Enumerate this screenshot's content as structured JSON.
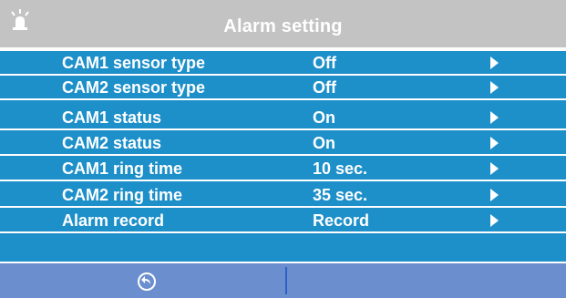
{
  "header": {
    "icon": "alarm-icon",
    "title": "Alarm setting"
  },
  "rows": [
    {
      "label": "CAM1 sensor type",
      "value": "Off"
    },
    {
      "label": "CAM2 sensor type",
      "value": "Off"
    },
    {
      "label": "CAM1 status",
      "value": "On"
    },
    {
      "label": "CAM2 status",
      "value": "On"
    },
    {
      "label": "CAM1 ring time",
      "value": "10 sec."
    },
    {
      "label": "CAM2 ring time",
      "value": "35 sec."
    },
    {
      "label": "Alarm record",
      "value": "Record"
    }
  ],
  "footer": {
    "back_icon": "back-circle-icon"
  },
  "colors": {
    "header_bg": "#c3c3c3",
    "list_bg": "#1d8fc9",
    "footer_bg": "#6b8fce",
    "text": "#ffffff"
  }
}
